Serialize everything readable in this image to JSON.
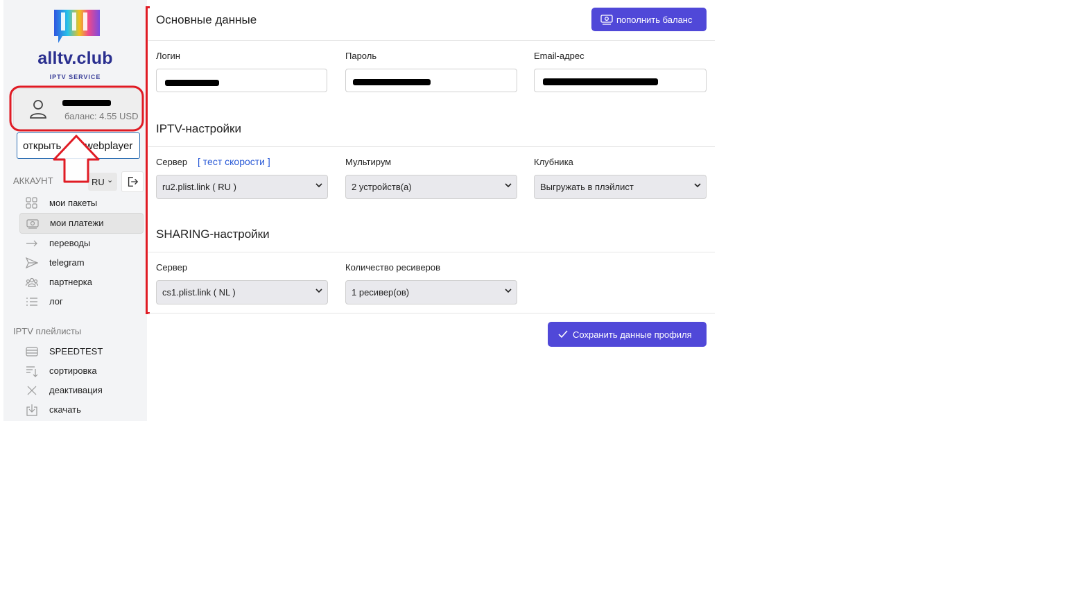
{
  "logo": {
    "name": "alltv.club",
    "subtitle": "IPTV SERVICE"
  },
  "user": {
    "balance_text": "баланс: 4.55 USD"
  },
  "webplayer": {
    "label_left": "открыть",
    "label_right": "webplayer"
  },
  "account": {
    "title": "АККАУНТ",
    "lang": "RU"
  },
  "nav": {
    "items": [
      {
        "label": "мои пакеты",
        "icon": "grid-icon"
      },
      {
        "label": "мои платежи",
        "icon": "payment-icon"
      },
      {
        "label": "переводы",
        "icon": "arrow-right-icon"
      },
      {
        "label": "telegram",
        "icon": "telegram-icon"
      },
      {
        "label": "партнерка",
        "icon": "people-icon"
      },
      {
        "label": "лог",
        "icon": "list-icon"
      }
    ]
  },
  "playlists": {
    "title": "IPTV плейлисты",
    "items": [
      {
        "label": "SPEEDTEST",
        "icon": "server-icon"
      },
      {
        "label": "сортировка",
        "icon": "sort-icon"
      },
      {
        "label": "деактивация",
        "icon": "close-icon"
      },
      {
        "label": "скачать",
        "icon": "download-icon"
      }
    ]
  },
  "main": {
    "basic_title": "Основные данные",
    "topup_label": "пополнить баланс",
    "login_label": "Логин",
    "password_label": "Пароль",
    "email_label": "Email-адрес",
    "iptv_title": "IPTV-настройки",
    "server_label": "Сервер",
    "speedtest_link": "[ тест скорости ]",
    "server_value": "ru2.plist.link ( RU )",
    "multiroom_label": "Мультирум",
    "multiroom_value": "2 устройств(а)",
    "strawberry_label": "Клубника",
    "strawberry_value": "Выгружать в плэйлист",
    "sharing_title": "SHARING-настройки",
    "sharing_server_label": "Сервер",
    "sharing_server_value": "cs1.plist.link ( NL )",
    "receivers_label": "Количество ресиверов",
    "receivers_value": "1 ресивер(ов)",
    "save_label": "Сохранить данные профиля"
  },
  "colors": {
    "accent": "#5048d8",
    "annotation_red": "#e01b24",
    "brand_text": "#2a2f8f"
  }
}
